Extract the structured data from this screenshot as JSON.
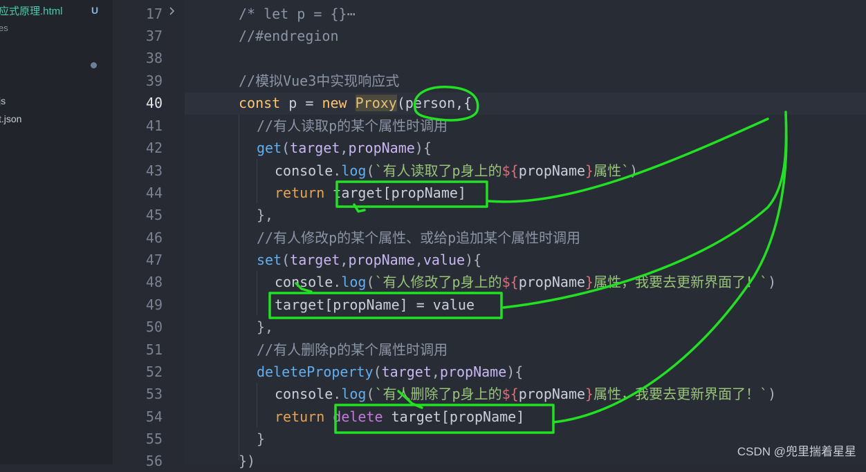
{
  "sidebar": {
    "items": [
      {
        "text": "应式原理.html",
        "badge": "U"
      },
      {
        "text": "es"
      },
      {
        "text": "js"
      },
      {
        "text": "t.json"
      }
    ]
  },
  "gutter": {
    "lines": [
      "17",
      "37",
      "38",
      "39",
      "40",
      "41",
      "42",
      "43",
      "44",
      "45",
      "46",
      "47",
      "48",
      "49",
      "50",
      "51",
      "52",
      "53",
      "54",
      "55",
      "56"
    ],
    "active": "40",
    "fold_icon": "chevron-right-icon"
  },
  "code": {
    "l17": "/* let p = {}⋯",
    "l37": "//#endregion",
    "l39": "//模拟Vue3中实现响应式",
    "l40_const": "const",
    "l40_p": " p = ",
    "l40_new": "new",
    "l40_sp": " ",
    "l40_proxy": "Proxy",
    "l40_open": "(",
    "l40_person": "person",
    "l40_close": ",{",
    "l41": "//有人读取p的某个属性时调用",
    "l42_fn": "get",
    "l42_a": "(",
    "l42_t": "target",
    "l42_c": ",",
    "l42_pn": "propName",
    "l42_e": "){",
    "l43_obj": "console",
    "l43_dot": ".",
    "l43_log": "log",
    "l43_open": "(",
    "l43_str1": "`有人读取了p身上的",
    "l43_d": "${",
    "l43_var": "propName",
    "l43_e": "}",
    "l43_str2": "属性`",
    "l43_close": ")",
    "l44_ret": "return",
    "l44_expr": " target[propName]",
    "l45": "},",
    "l46": "//有人修改p的某个属性、或给p追加某个属性时调用",
    "l47_fn": "set",
    "l47_a": "(",
    "l47_t": "target",
    "l47_c": ",",
    "l47_pn": "propName",
    "l47_c2": ",",
    "l47_v": "value",
    "l47_e": "){",
    "l48_obj": "console",
    "l48_dot": ".",
    "l48_log": "log",
    "l48_open": "(",
    "l48_str1": "`有人修改了p身上的",
    "l48_d": "${",
    "l48_var": "propName",
    "l48_e": "}",
    "l48_str2": "属性，我要去更新界面了！`",
    "l48_close": ")",
    "l49": "target[propName] = value",
    "l50": "},",
    "l51": "//有人删除p的某个属性时调用",
    "l52_fn": "deleteProperty",
    "l52_a": "(",
    "l52_t": "target",
    "l52_c": ",",
    "l52_pn": "propName",
    "l52_e": "){",
    "l53_obj": "console",
    "l53_dot": ".",
    "l53_log": "log",
    "l53_open": "(",
    "l53_str1": "`有人删除了p身上的",
    "l53_d": "${",
    "l53_var": "propName",
    "l53_e": "}",
    "l53_str2": "属性，我要去更新界面了！`",
    "l53_close": ")",
    "l54_ret": "return",
    "l54_del": " delete",
    "l54_expr": " target[propName]",
    "l55": "}",
    "l56": "})"
  },
  "watermark": "CSDN @兜里揣着星星",
  "colors": {
    "annotation": "#22e022",
    "background": "#282c34"
  }
}
